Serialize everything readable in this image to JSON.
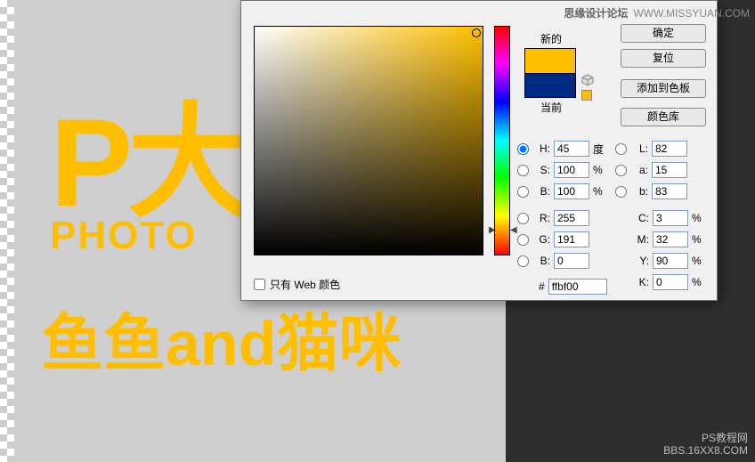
{
  "watermarks": {
    "top_label": "思缘设计论坛",
    "top_url": "WWW.MISSYUAN.COM",
    "bottom_label": "PS教程网",
    "bottom_url": "BBS.16XX8.COM"
  },
  "artwork": {
    "big": "P大",
    "mid": "PHOTO",
    "low": "鱼鱼and猫咪"
  },
  "picker": {
    "buttons": {
      "ok": "确定",
      "reset": "复位",
      "add": "添加到色板",
      "lib": "颜色库"
    },
    "labels": {
      "new": "新的",
      "current": "当前",
      "web_only": "只有 Web 颜色"
    },
    "new_color": "#ffbf00",
    "current_color": "#002984",
    "hsb": {
      "H": "45",
      "S": "100",
      "B": "100",
      "h_unit": "度",
      "pct": "%"
    },
    "rgb": {
      "R": "255",
      "G": "191",
      "B": "0"
    },
    "lab": {
      "L": "82",
      "a": "15",
      "b": "83"
    },
    "cmyk": {
      "C": "3",
      "M": "32",
      "Y": "90",
      "K": "0"
    },
    "hex_label": "#",
    "hex": "ffbf00"
  }
}
